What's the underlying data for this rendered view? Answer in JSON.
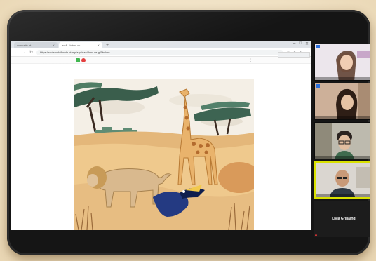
{
  "browser": {
    "tabs": [
      {
        "label": "www.site.pt",
        "active": false
      },
      {
        "label": "ecrã - Inbox cc...",
        "active": true
      }
    ],
    "new_tab_symbol": "+",
    "window_controls": [
      "–",
      "□",
      "✕"
    ],
    "url": "https://sudebolk-filmde.pt/mp/a/pt/nao/?em-de-g/Sbclore",
    "note_label": "",
    "menu_symbol": "⋮"
  },
  "scene": {
    "animals": [
      "lion",
      "giraffe",
      "toucan"
    ],
    "sky_color": "#f2eee6",
    "ground_color": "#e4b77a"
  },
  "participants": [
    {
      "name": "",
      "kind": "girl-long-hair",
      "bg": "#e9e4e9",
      "speaking": false
    },
    {
      "name": "",
      "kind": "girl-dark-hair",
      "bg": "#c9a98c",
      "speaking": false
    },
    {
      "name": "",
      "kind": "boy-glasses",
      "bg": "#b9b7a9",
      "speaking": false
    },
    {
      "name": "",
      "kind": "man-bald",
      "bg": "#d6d3cd",
      "speaking": true
    }
  ],
  "name_tile": {
    "label": "Livia Grinaindi"
  },
  "colors": {
    "accent_green": "#3bb54a",
    "accent_red": "#e33a3a",
    "speaker_outline": "#d9e100"
  }
}
